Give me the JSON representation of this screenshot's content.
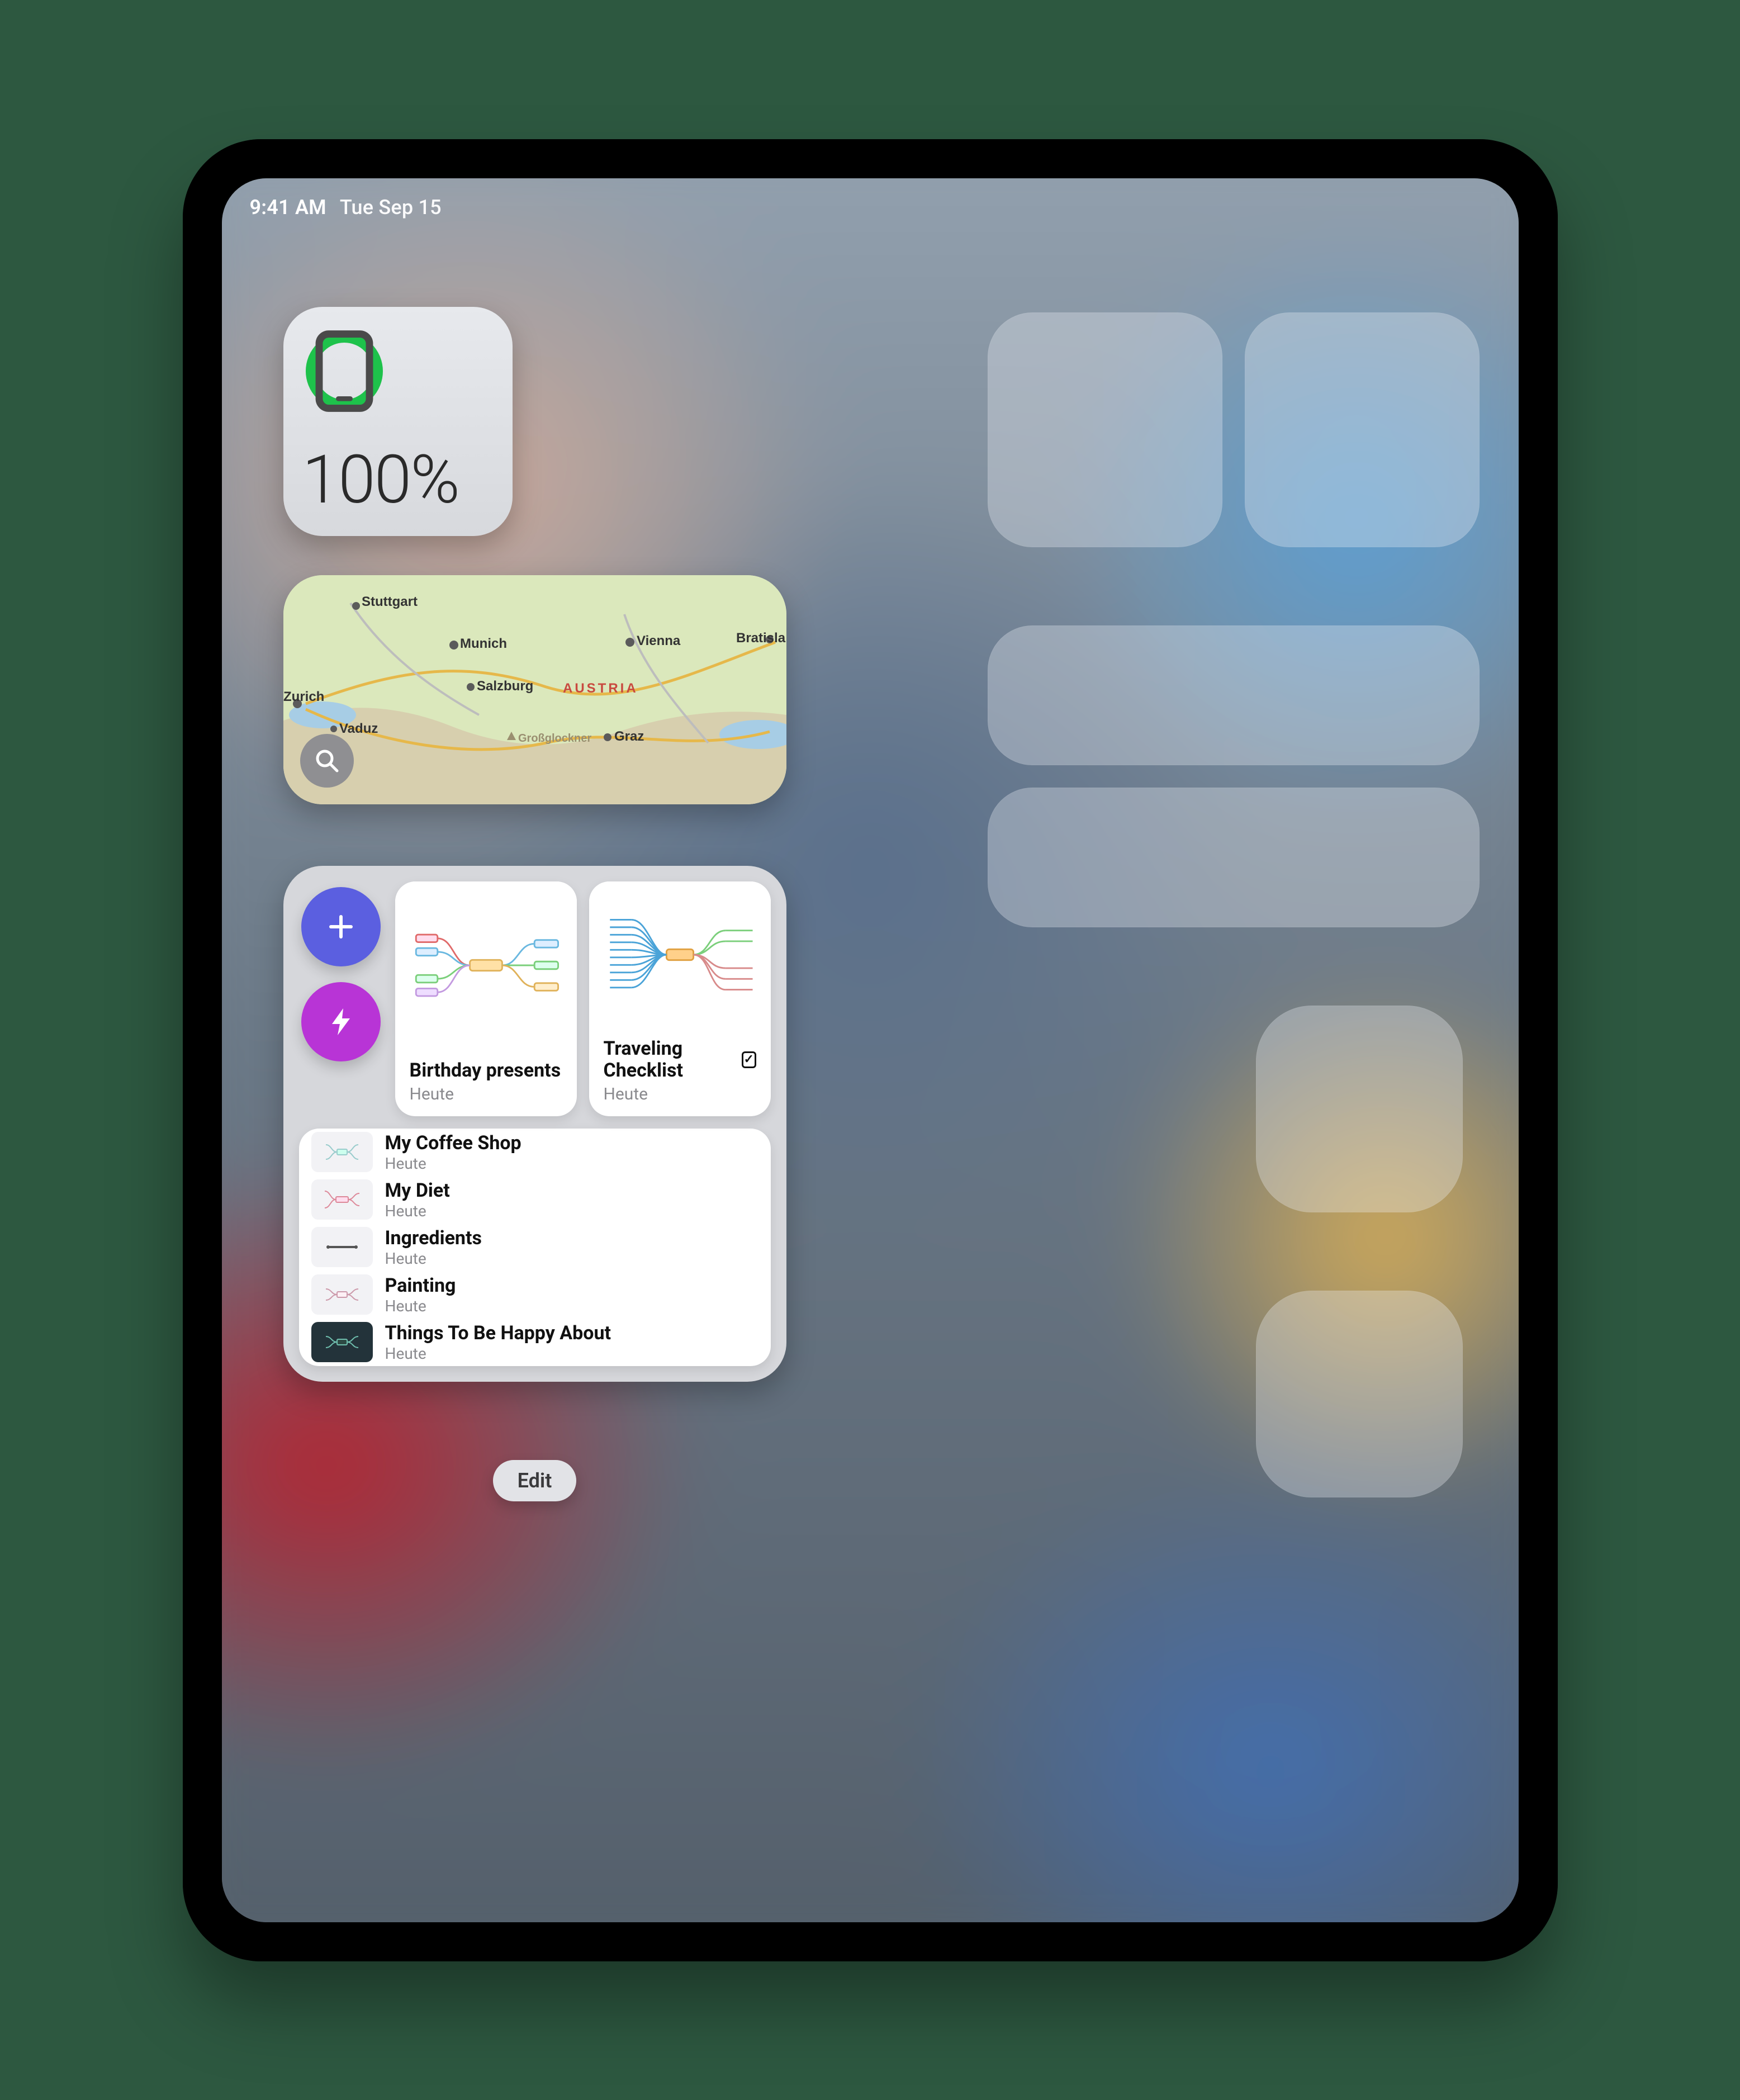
{
  "status": {
    "time": "9:41 AM",
    "date": "Tue Sep 15"
  },
  "battery": {
    "percent_label": "100%",
    "ring_color": "#1ec24b"
  },
  "map": {
    "country_label": "AUSTRIA",
    "cities": [
      "Stuttgart",
      "Munich",
      "Vienna",
      "Bratisla",
      "Zurich",
      "Salzburg",
      "Graz",
      "Vaduz"
    ],
    "feature": "Großglockner"
  },
  "notes": {
    "cards": [
      {
        "title": "Birthday presents",
        "sub": "Heute",
        "badge": false
      },
      {
        "title": "Traveling Checklist",
        "sub": "Heute",
        "badge": true
      }
    ],
    "list": [
      {
        "title": "My Coffee Shop",
        "sub": "Heute",
        "dark": false
      },
      {
        "title": "My Diet",
        "sub": "Heute",
        "dark": false
      },
      {
        "title": "Ingredients",
        "sub": "Heute",
        "dark": false
      },
      {
        "title": "Painting",
        "sub": "Heute",
        "dark": false
      },
      {
        "title": "Things To Be Happy About",
        "sub": "Heute",
        "dark": true
      }
    ]
  },
  "edit_label": "Edit"
}
